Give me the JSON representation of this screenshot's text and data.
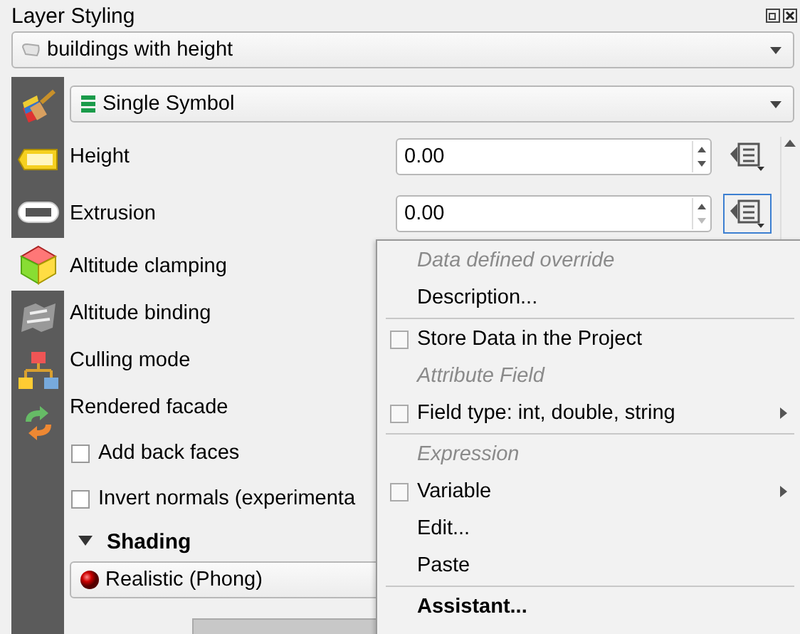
{
  "panel": {
    "title": "Layer Styling",
    "layer": "buildings with height",
    "renderer": "Single Symbol"
  },
  "sidebar": {
    "items": [
      {
        "selected": false
      },
      {
        "selected": false
      },
      {
        "selected": false
      },
      {
        "selected": true
      },
      {
        "selected": false
      },
      {
        "selected": false
      },
      {
        "selected": false
      }
    ]
  },
  "rows": [
    {
      "kind": "number",
      "label": "Height",
      "value": "0.00",
      "focused": false
    },
    {
      "kind": "number",
      "label": "Extrusion",
      "value": "0.00",
      "focused": true
    },
    {
      "kind": "label",
      "label": "Altitude clamping"
    },
    {
      "kind": "label",
      "label": "Altitude binding"
    },
    {
      "kind": "label",
      "label": "Culling mode"
    },
    {
      "kind": "label",
      "label": "Rendered facade"
    },
    {
      "kind": "checkbox",
      "label": "Add back faces",
      "checked": false
    },
    {
      "kind": "checkbox",
      "label": "Invert normals (experimenta",
      "checked": false
    }
  ],
  "shading": {
    "title": "Shading",
    "expanded": true,
    "model": "Realistic (Phong)"
  },
  "menu": {
    "items": [
      {
        "kind": "heading",
        "label": "Data defined override"
      },
      {
        "kind": "action",
        "label": "Description..."
      },
      {
        "kind": "separator"
      },
      {
        "kind": "checkbox",
        "label": "Store Data in the Project",
        "checked": false
      },
      {
        "kind": "heading",
        "label": "Attribute Field"
      },
      {
        "kind": "checkbox",
        "label": "Field type: int, double, string",
        "checked": false,
        "submenu": true
      },
      {
        "kind": "separator"
      },
      {
        "kind": "heading",
        "label": "Expression"
      },
      {
        "kind": "checkbox",
        "label": "Variable",
        "checked": false,
        "submenu": true
      },
      {
        "kind": "action",
        "label": "Edit..."
      },
      {
        "kind": "action",
        "label": "Paste"
      },
      {
        "kind": "separator"
      },
      {
        "kind": "action",
        "label": "Assistant...",
        "default": true
      }
    ]
  }
}
